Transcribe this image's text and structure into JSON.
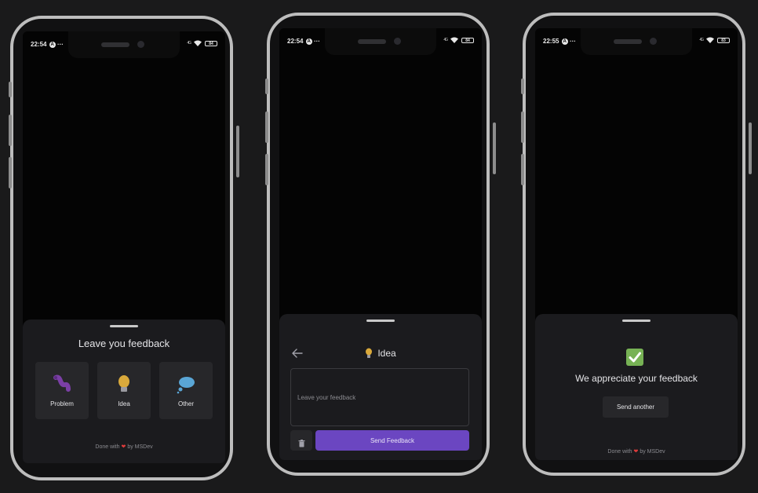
{
  "phones": {
    "first": {
      "status": {
        "time": "22:54",
        "battery": "84"
      },
      "sheet": {
        "title": "Leave you feedback",
        "options": [
          {
            "label": "Problem",
            "icon": "worm-icon",
            "color": "#7b3fa6"
          },
          {
            "label": "Idea",
            "icon": "lightbulb-icon",
            "color": "#d9a93b"
          },
          {
            "label": "Other",
            "icon": "thought-bubble-icon",
            "color": "#5aa6d6"
          }
        ],
        "footer": {
          "prefix": "Done with",
          "suffix": "by MSDev",
          "heart": "❤"
        }
      }
    },
    "second": {
      "status": {
        "time": "22:54",
        "battery": "84"
      },
      "sheet": {
        "heading": "Idea",
        "feedback_placeholder": "Leave your feedback",
        "send_label": "Send Feedback",
        "accent": "#6b46c1"
      }
    },
    "third": {
      "status": {
        "time": "22:55",
        "battery": "83"
      },
      "sheet": {
        "message": "We appreciate your feedback",
        "send_another_label": "Send another",
        "footer": {
          "prefix": "Done with",
          "suffix": "by MSDev",
          "heart": "❤"
        }
      }
    }
  },
  "status_icons": {
    "network": "A",
    "more": "···",
    "signal": "4G"
  }
}
